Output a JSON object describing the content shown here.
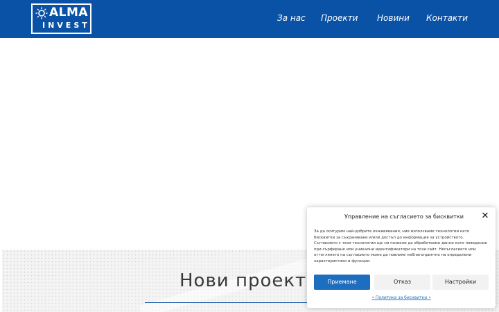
{
  "logo": {
    "top": "ALMA",
    "bottom": "INVEST"
  },
  "nav": {
    "items": [
      {
        "label": "За нас"
      },
      {
        "label": "Проекти"
      },
      {
        "label": "Новини"
      },
      {
        "label": "Контакти"
      }
    ]
  },
  "section": {
    "title": "Нови проект"
  },
  "cookie": {
    "title": "Управление на съгласието за бисквитки",
    "close_icon": "close-icon",
    "body": "За да осигурим най-добрите изживявания, ние използваме технологии като бисквитки за съхраняване и/или достъп до информация за устройството. Съгласието с тези технологии ще ни позволи да обработваме данни като поведение при сърфиране или уникални идентификатори на този сайт. Несъгласието или оттеглянето на съгласието може да повлияе неблагоприятно на определени характеристики и функции.",
    "accept_label": "Приемане",
    "deny_label": "Отказ",
    "settings_label": "Настройки",
    "policy_label": "Политика за бисквитки"
  },
  "colors": {
    "brand": "#0a52a6",
    "accept": "#1e6ec0"
  }
}
